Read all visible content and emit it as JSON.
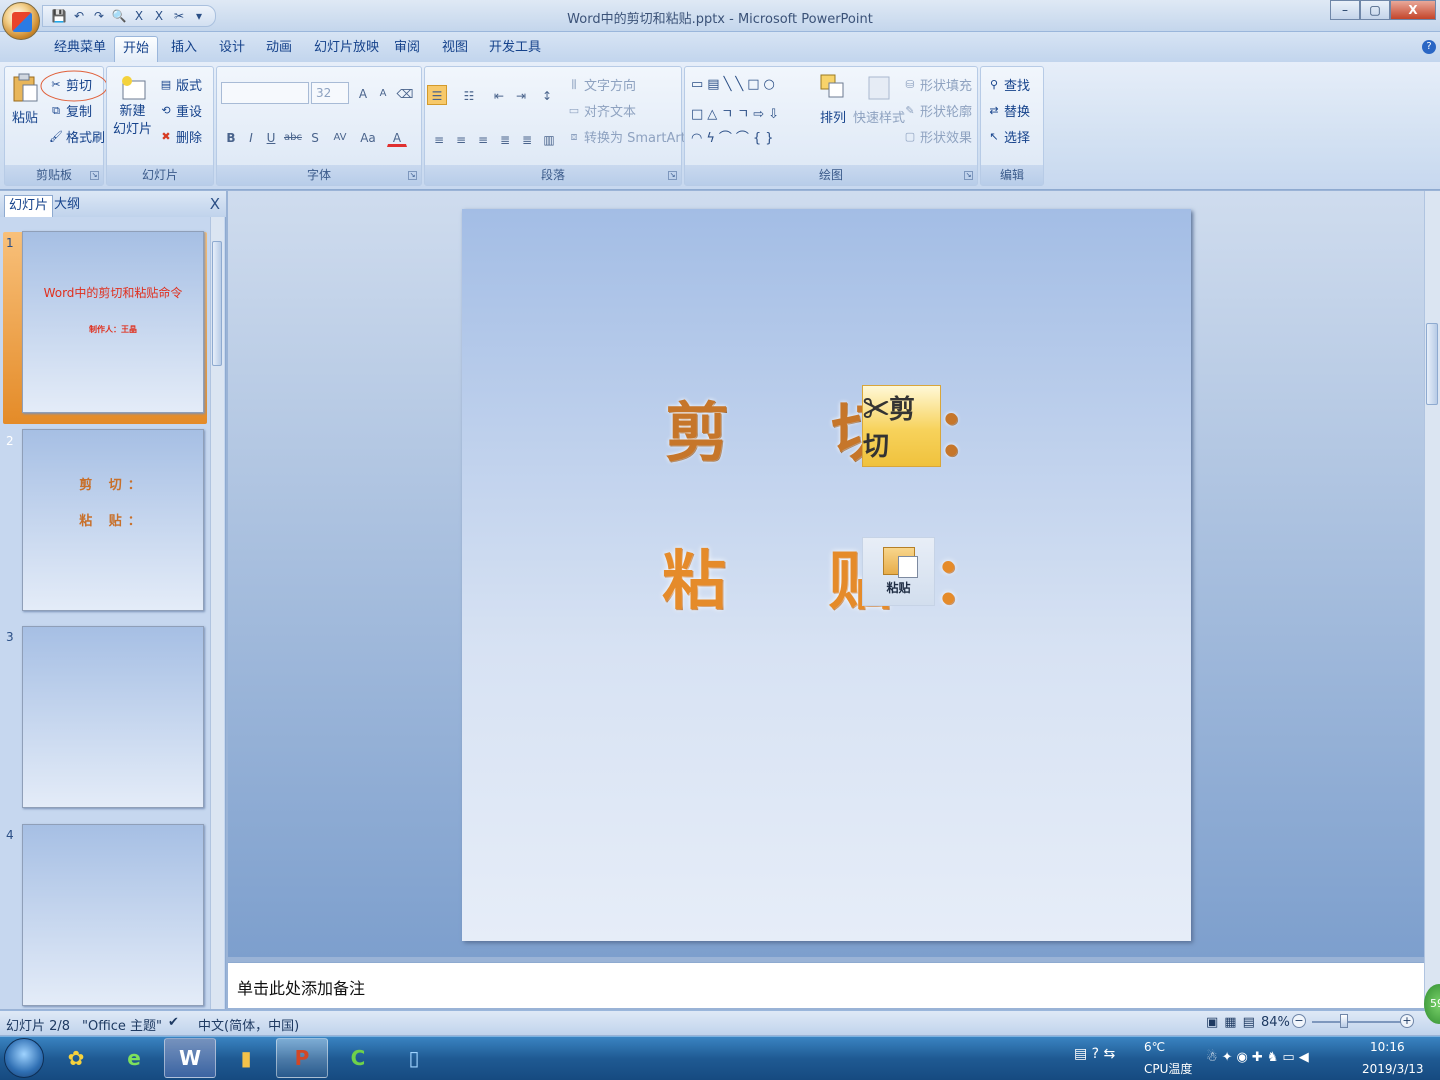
{
  "window": {
    "title": "Word中的剪切和粘贴.pptx - Microsoft PowerPoint",
    "min": "–",
    "max": "▢",
    "close": "X"
  },
  "qat": [
    "💾",
    "↶",
    "↷",
    "🔍",
    "X",
    "X",
    "✂",
    "▾"
  ],
  "tabs": [
    "经典菜单",
    "开始",
    "插入",
    "设计",
    "动画",
    "幻灯片放映",
    "审阅",
    "视图",
    "开发工具"
  ],
  "help": "?",
  "ribbon": {
    "clipboard": {
      "label": "剪贴板",
      "paste": "粘贴",
      "cut": "剪切",
      "copy": "复制",
      "format_painter": "格式刷"
    },
    "slides": {
      "label": "幻灯片",
      "new_slide_1": "新建",
      "new_slide_2": "幻灯片",
      "layout": "版式",
      "reset": "重设",
      "delete": "删除"
    },
    "font": {
      "label": "字体",
      "font_name": "",
      "font_size": "32",
      "grow": "A",
      "shrink": "A",
      "bold": "B",
      "italic": "I",
      "underline": "U",
      "strike": "abc",
      "shadow": "S",
      "spacing": "AV",
      "case": "Aa",
      "color": "A"
    },
    "paragraph": {
      "label": "段落",
      "text_direction": "文字方向",
      "align_text": "对齐文本",
      "smartart": "转换为 SmartArt"
    },
    "drawing": {
      "label": "绘图",
      "arrange": "排列",
      "quick_styles": "快速样式",
      "shape_fill": "形状填充",
      "shape_outline": "形状轮廓",
      "shape_effects": "形状效果",
      "shapes_row1": "▭▤╲╲□○",
      "shapes_row2": "□△ㄱㄱ⇨⇩",
      "shapes_row3": "◠ϟ⌒⌒{}"
    },
    "editing": {
      "label": "编辑",
      "find": "查找",
      "replace": "替换",
      "select": "选择"
    }
  },
  "left_panel": {
    "tab_slides": "幻灯片",
    "tab_outline": "大纲",
    "close": "X"
  },
  "thumbnails": [
    {
      "num": "1",
      "title": "Word中的剪切和粘贴命令",
      "sub": "制作人：王晶"
    },
    {
      "num": "2",
      "row1": "剪 切：",
      "row2": "粘 贴："
    },
    {
      "num": "3"
    },
    {
      "num": "4"
    }
  ],
  "slide": {
    "cut_label": "剪 切：",
    "paste_label": "粘 贴：",
    "cut_button": "✂剪切",
    "paste_button": "粘贴"
  },
  "notes": {
    "placeholder": "单击此处添加备注"
  },
  "status": {
    "slide": "幻灯片 2/8",
    "theme": "\"Office 主题\"",
    "language": "中文(简体，中国)",
    "zoom": "84%",
    "zoom_minus": "−",
    "zoom_plus": "+"
  },
  "taskbar": {
    "temp": "6℃",
    "cpu": "CPU温度",
    "time": "10:16",
    "date": "2019/3/13",
    "badge": "59"
  }
}
